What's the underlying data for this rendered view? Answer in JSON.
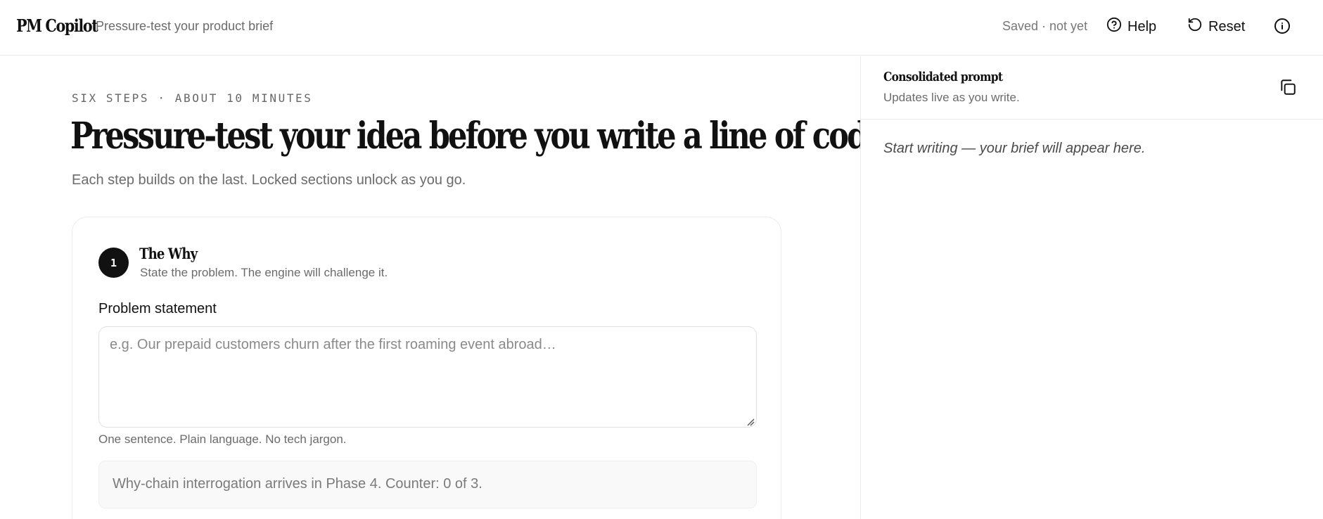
{
  "header": {
    "brand": "PM Copilot",
    "tagline": "Pressure-test your product brief",
    "saved_status": "Saved · not yet",
    "help_label": "Help",
    "reset_label": "Reset",
    "icons": [
      "help-circle-icon",
      "reset-icon",
      "info-icon"
    ]
  },
  "intro": {
    "eyebrow": "SIX STEPS · ABOUT 10 MINUTES",
    "headline": "Pressure-test your idea before you write a line of code.",
    "subhead": "Each step builds on the last. Locked sections unlock as you go."
  },
  "step1": {
    "number": "1",
    "title": "The Why",
    "subtitle": "State the problem. The engine will challenge it.",
    "field_label": "Problem statement",
    "field_value": "",
    "field_placeholder": "e.g. Our prepaid customers churn after the first roaming event abroad…",
    "hint": "One sentence. Plain language. No tech jargon.",
    "notice": "Why-chain interrogation arrives in Phase 4. Counter: 0 of 3."
  },
  "side_panel": {
    "title": "Consolidated prompt",
    "subtitle": "Updates live as you write.",
    "empty_state": "Start writing — your brief will appear here.",
    "copy_icon": "copy-icon"
  }
}
